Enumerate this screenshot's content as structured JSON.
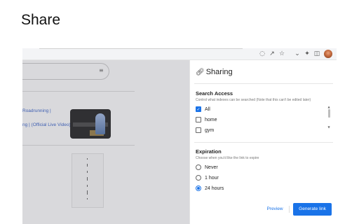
{
  "heading": "Share",
  "page": {
    "result_title": "Roadrunning |",
    "result_subtitle": "ng | (Official Live Video)"
  },
  "toolbar": {
    "icons": [
      "google-lens-icon",
      "share-icon",
      "bookmark-star-icon",
      "chevron-down-icon",
      "extensions-puzzle-icon",
      "side-panel-icon",
      "profile-avatar"
    ]
  },
  "sharing": {
    "title": "Sharing",
    "search_access": {
      "title": "Search Access",
      "description": "Control what indexes can be searched (Note that this can't be edited later)",
      "options": [
        {
          "label": "All",
          "checked": true
        },
        {
          "label": "home",
          "checked": false
        },
        {
          "label": "gym",
          "checked": false
        }
      ]
    },
    "expiration": {
      "title": "Expiration",
      "description": "Choose when you'd like the link to expire",
      "options": [
        {
          "label": "Never",
          "selected": false
        },
        {
          "label": "1 hour",
          "selected": false
        },
        {
          "label": "24 hours",
          "selected": true
        }
      ]
    },
    "preview_label": "Preview",
    "generate_label": "Generate link"
  },
  "colors": {
    "accent": "#1a73e8",
    "overlay": "#78788280"
  }
}
